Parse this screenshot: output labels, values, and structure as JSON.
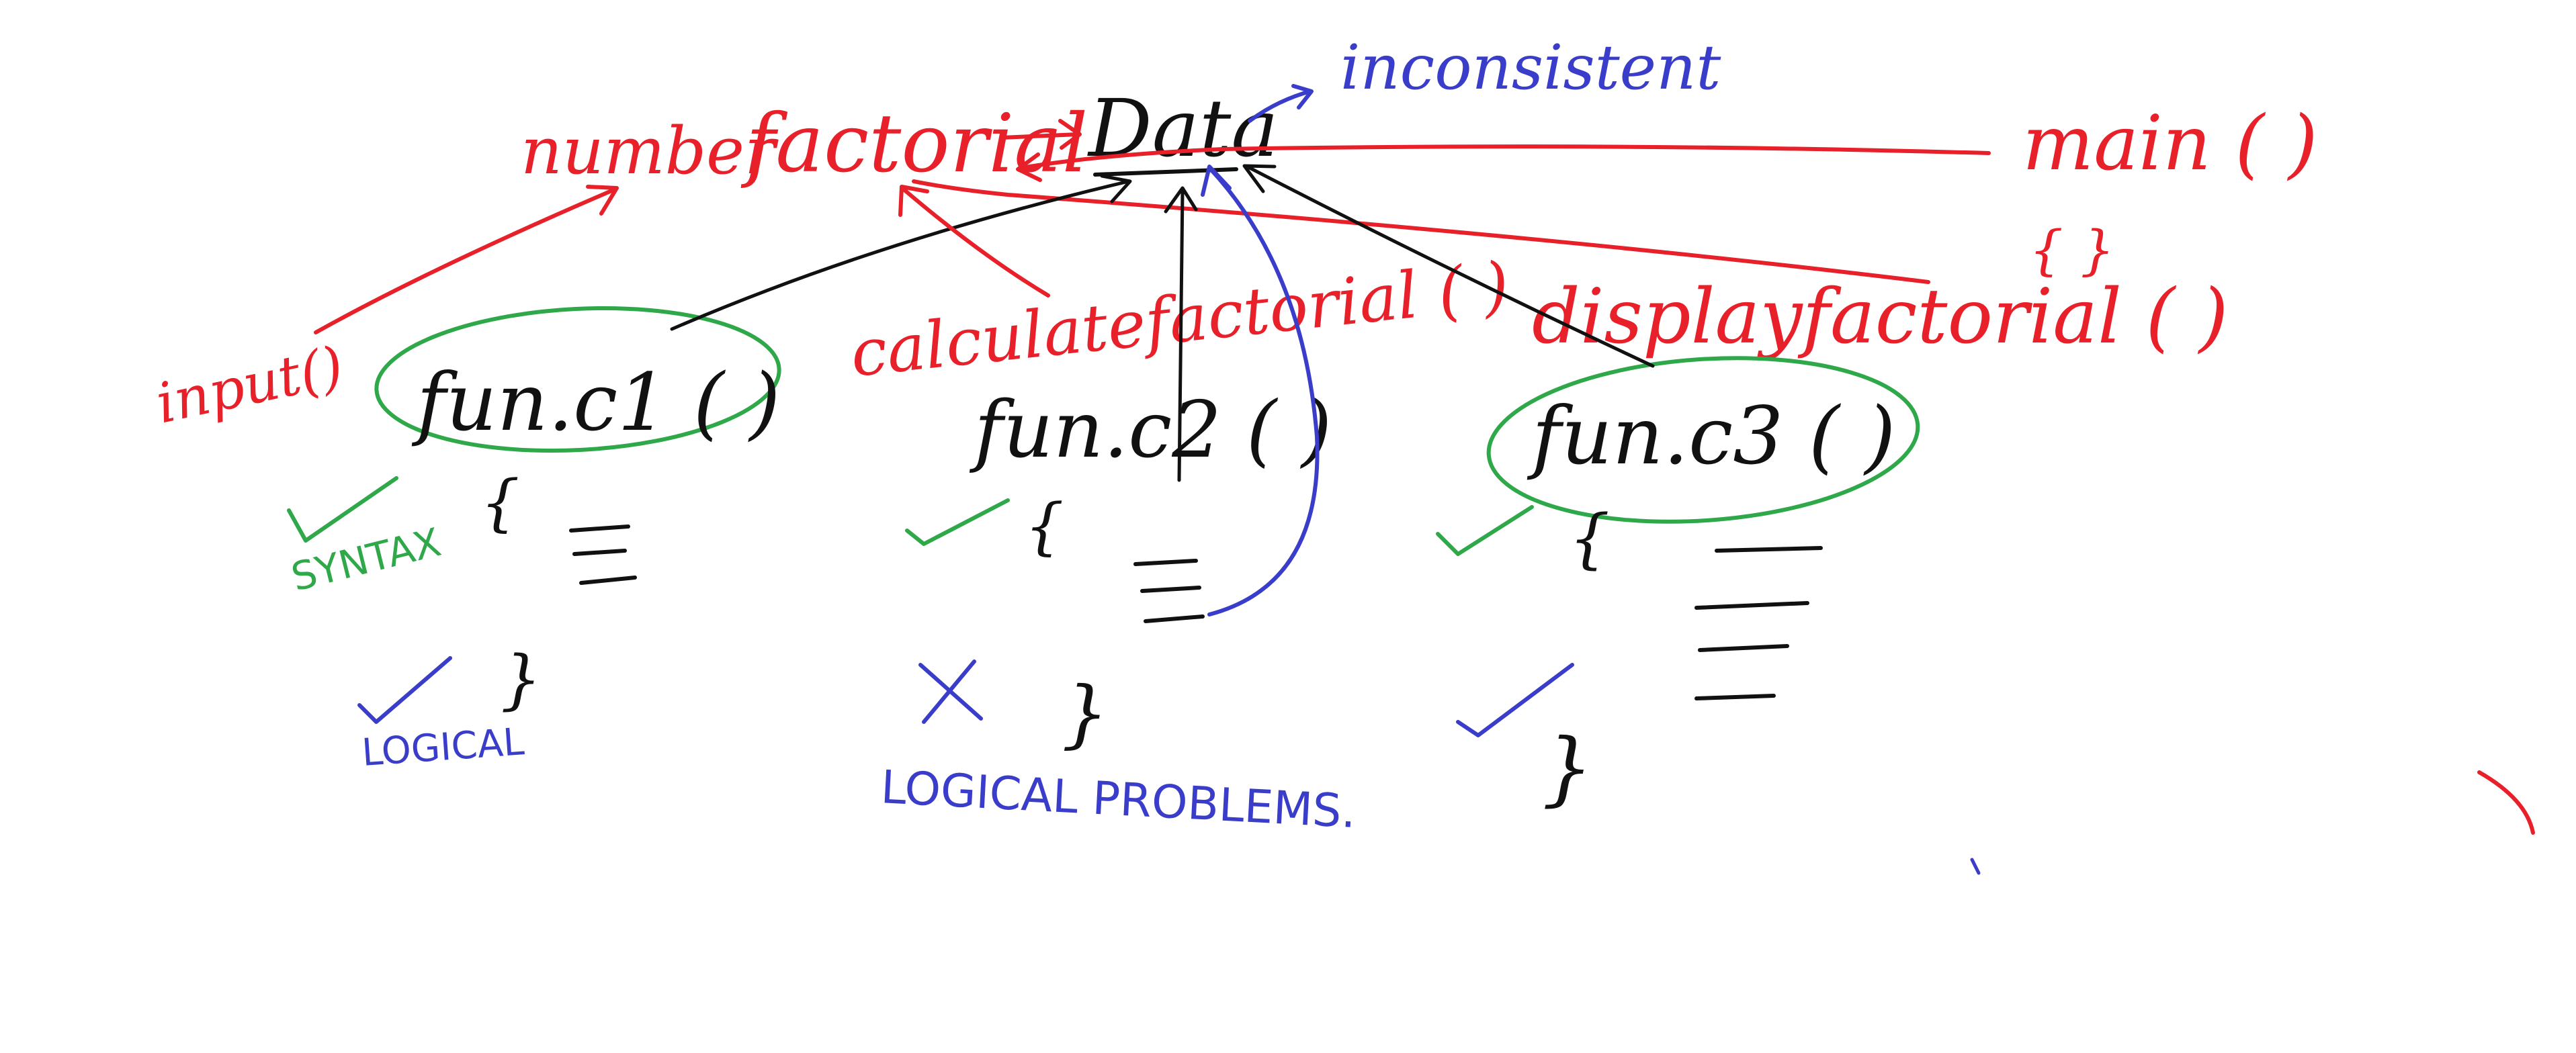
{
  "colors": {
    "background": "#ffffff",
    "red": "#e8202a",
    "black": "#111111",
    "blue": "#3a3dc9",
    "green": "#2fa84a"
  },
  "labels": {
    "data": "Data",
    "inconsistent": "inconsistent",
    "number": "number",
    "factorial": "factorial",
    "main": "main ( )",
    "input": "input()",
    "calculate_factorial": "calculatefactorial ( )",
    "display_factorial": "displayfactorial ( )",
    "fun1": "fun.c1 ( )",
    "fun2": "fun.c2 ( )",
    "fun3": "fun.c3 ( )",
    "open_brace": "{",
    "close_brace": "}",
    "main_braces": "{ }",
    "syntax": "SYNTAX",
    "logical": "LOGICAL",
    "logical_problems": "LOGICAL PROBLEMS.",
    "check": "✓",
    "cross": "X"
  }
}
